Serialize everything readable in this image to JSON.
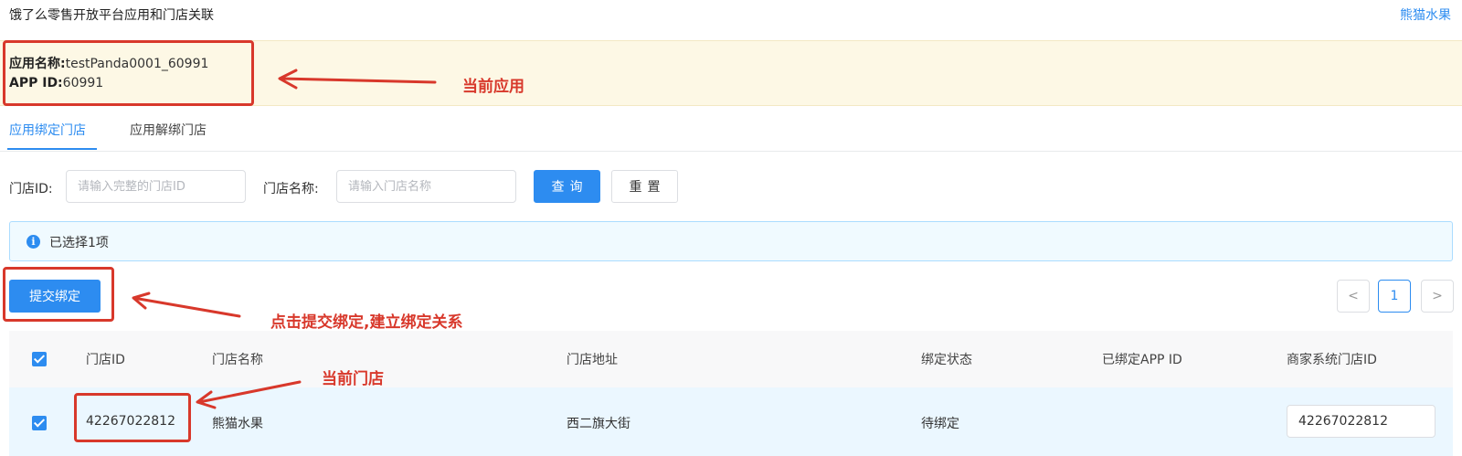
{
  "header": {
    "title": "饿了么零售开放平台应用和门店关联",
    "store_link": "熊猫水果"
  },
  "app_info": {
    "name_label": "应用名称:",
    "name_value": "testPanda0001_60991",
    "id_label": "APP ID:",
    "id_value": "60991"
  },
  "tabs": [
    {
      "label": "应用绑定门店",
      "active": true
    },
    {
      "label": "应用解绑门店",
      "active": false
    }
  ],
  "filters": {
    "store_id_label": "门店ID:",
    "store_id_placeholder": "请输入完整的门店ID",
    "store_name_label": "门店名称:",
    "store_name_placeholder": "请输入门店名称",
    "search_label": "查询",
    "reset_label": "重置"
  },
  "alert": {
    "icon": "info-icon",
    "text": "已选择1项"
  },
  "submit_label": "提交绑定",
  "pagination": {
    "prev": "<",
    "current": "1",
    "next": ">"
  },
  "table": {
    "columns": [
      "门店ID",
      "门店名称",
      "门店地址",
      "绑定状态",
      "已绑定APP ID",
      "商家系统门店ID"
    ],
    "rows": [
      {
        "store_id": "42267022812",
        "store_name": "熊猫水果",
        "address": "西二旗大街",
        "status": "待绑定",
        "bound_app_id": "",
        "merchant_store_id": "42267022812"
      }
    ]
  },
  "annotations": {
    "current_app": "当前应用",
    "submit_hint": "点击提交绑定,建立绑定关系",
    "current_store": "当前门店"
  },
  "colors": {
    "primary": "#2d8cf0",
    "annotation": "#d8382b",
    "app_info_bg": "#fdf8e5",
    "alert_bg": "#f0faff"
  }
}
